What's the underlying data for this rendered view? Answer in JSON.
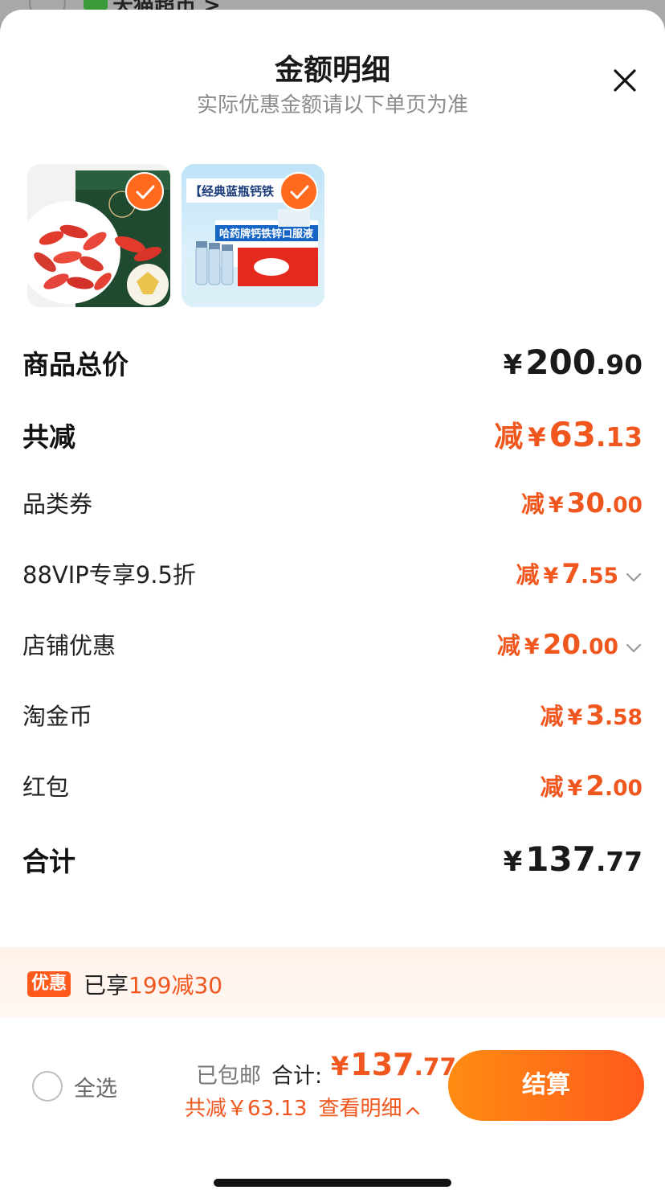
{
  "behind": {
    "store_name": "天猫超市 >"
  },
  "header": {
    "title": "金额明细",
    "subtitle": "实际优惠金额请以下单页为准"
  },
  "products": [
    {
      "alt": "枸杞",
      "selected": true
    },
    {
      "alt": "哈药牌钙铁锌口服液",
      "banner_text": "【经典蓝瓶钙铁",
      "box_text": "哈药牌钙铁锌口服液",
      "selected": true
    }
  ],
  "rows": {
    "total_price": {
      "label": "商品总价",
      "currency": "¥",
      "int": "200",
      "dec": ".90"
    },
    "total_reduce": {
      "label": "共减",
      "prefix": "减",
      "currency": "¥",
      "int": "63",
      "dec": ".13"
    },
    "category_coupon": {
      "label": "品类券",
      "prefix": "减",
      "currency": "¥",
      "int": "30",
      "dec": ".00"
    },
    "vip_discount": {
      "label": "88VIP专享9.5折",
      "prefix": "减",
      "currency": "¥",
      "int": "7",
      "dec": ".55"
    },
    "store_discount": {
      "label": "店铺优惠",
      "prefix": "减",
      "currency": "¥",
      "int": "20",
      "dec": ".00"
    },
    "taojinbi": {
      "label": "淘金币",
      "prefix": "减",
      "currency": "¥",
      "int": "3",
      "dec": ".58"
    },
    "red_packet": {
      "label": "红包",
      "prefix": "减",
      "currency": "¥",
      "int": "2",
      "dec": ".00"
    },
    "grand_total": {
      "label": "合计",
      "currency": "¥",
      "int": "137",
      "dec": ".77"
    }
  },
  "promo": {
    "badge": "优惠",
    "text_prefix": "已享",
    "text_highlight": "199减30"
  },
  "bottom_bar": {
    "select_all": "全选",
    "shipping": "已包邮",
    "total_label": "合计:",
    "total_currency": "¥",
    "total_int": "137",
    "total_dec": ".77",
    "reduce_text": "共减￥63.13",
    "details_link": "查看明细",
    "checkout_label": "结算"
  },
  "colors": {
    "accent": "#f0571e",
    "button_start": "#ff8c12",
    "button_end": "#ff5a1c"
  }
}
